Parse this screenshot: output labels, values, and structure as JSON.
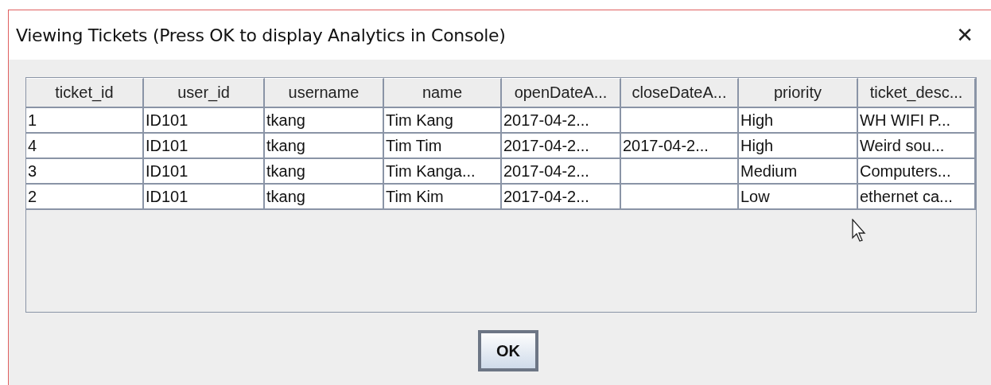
{
  "window": {
    "title": "Viewing Tickets (Press OK to display Analytics in Console)",
    "close": "✕"
  },
  "table": {
    "columns": [
      "ticket_id",
      "user_id",
      "username",
      "name",
      "openDateA...",
      "closeDateA...",
      "priority",
      "ticket_desc..."
    ],
    "rows": [
      [
        "1",
        "ID101",
        "tkang",
        "Tim Kang",
        "2017-04-2...",
        null,
        "High",
        "WH WIFI P..."
      ],
      [
        "4",
        "ID101",
        "tkang",
        "Tim Tim",
        "2017-04-2...",
        "2017-04-2...",
        "High",
        "Weird sou..."
      ],
      [
        "3",
        "ID101",
        "tkang",
        "Tim Kanga...",
        "2017-04-2...",
        null,
        "Medium",
        "Computers..."
      ],
      [
        "2",
        "ID101",
        "tkang",
        "Tim Kim",
        "2017-04-2...",
        null,
        "Low",
        "ethernet ca..."
      ]
    ]
  },
  "buttons": [
    "OK"
  ]
}
